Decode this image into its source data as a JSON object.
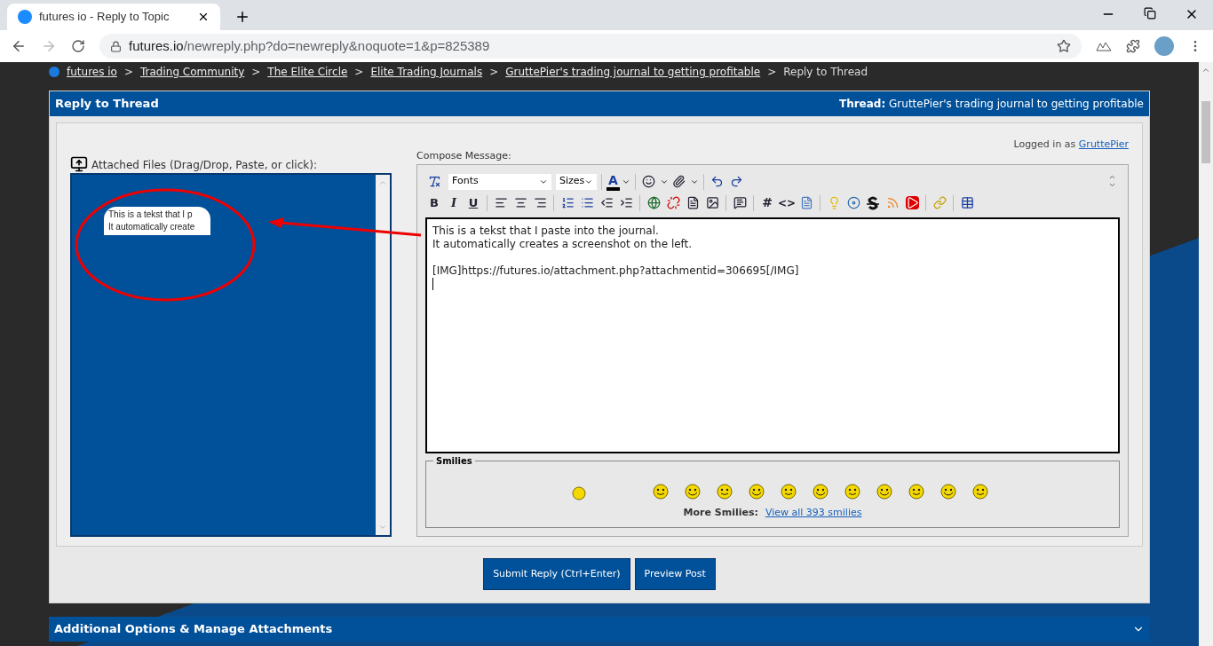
{
  "browser": {
    "tab_title": "futures io - Reply to Topic",
    "url_host": "futures.io",
    "url_path": "/newreply.php?do=newreply&noquote=1&p=825389"
  },
  "breadcrumb": [
    {
      "label": "futures io",
      "link": true
    },
    {
      "label": "Trading Community",
      "link": true
    },
    {
      "label": "The Elite Circle",
      "link": true
    },
    {
      "label": "Elite Trading Journals",
      "link": true
    },
    {
      "label": "GruttePier's trading journal to getting profitable",
      "link": true
    },
    {
      "label": "Reply to Thread",
      "link": false
    }
  ],
  "breadcrumb_separator": ">",
  "panel": {
    "title": "Reply to Thread",
    "thread_label": "Thread:",
    "thread_title": "GruttePier's trading journal to getting profitable"
  },
  "login": {
    "prefix": "Logged in as",
    "user": "GruttePier"
  },
  "attachments": {
    "label": "Attached Files (Drag/Drop, Paste, or click):",
    "thumbnail_lines": [
      "This is a tekst that I p",
      "It automatically create"
    ]
  },
  "compose": {
    "label": "Compose Message:",
    "font_select": "Fonts",
    "size_select": "Sizes",
    "color_letter": "A",
    "format_buttons": [
      "B",
      "I",
      "U"
    ],
    "hash_button": "#",
    "code_button": "<>",
    "message_paragraphs": [
      [
        "This is a tekst that I paste into the journal.",
        "It automatically creates a screenshot on the left."
      ],
      [
        "[IMG]https://futures.io/attachment.php?attachmentid=306695[/IMG]"
      ]
    ]
  },
  "smilies": {
    "title": "Smilies",
    "more_label": "More Smilies:",
    "more_link": "View all 393 smilies"
  },
  "buttons": [
    {
      "label": "Submit Reply (Ctrl+Enter)"
    },
    {
      "label": "Preview Post"
    }
  ],
  "options_bar": {
    "title": "Additional Options & Manage Attachments",
    "expanded": false
  }
}
